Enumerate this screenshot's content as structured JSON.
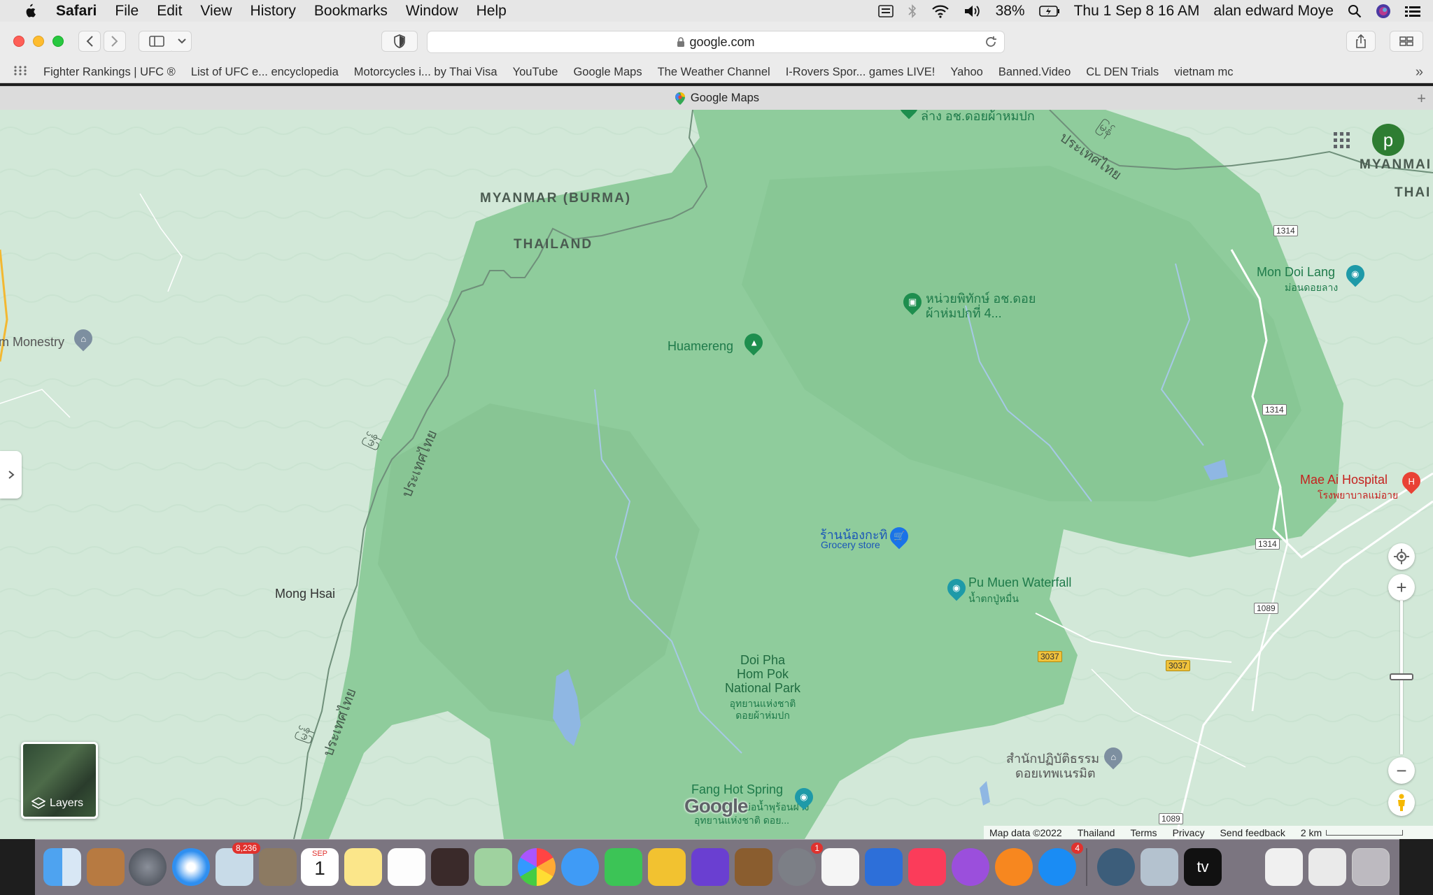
{
  "menubar": {
    "app": "Safari",
    "items": [
      "File",
      "Edit",
      "View",
      "History",
      "Bookmarks",
      "Window",
      "Help"
    ],
    "battery": "38%",
    "datetime": "Thu 1 Sep  8 16 AM",
    "user": "alan edward Moye"
  },
  "toolbar": {
    "url": "google.com"
  },
  "bookmarks": [
    "Fighter Rankings | UFC ®",
    "List of UFC e... encyclopedia",
    "Motorcycles i... by Thai Visa",
    "YouTube",
    "Google Maps",
    "The Weather Channel",
    "I-Rovers Spor... games LIVE!",
    "Yahoo",
    "Banned.Video",
    "CL DEN Trials",
    "vietnam mc"
  ],
  "tab": {
    "title": "Google Maps"
  },
  "map": {
    "avatar_letter": "p",
    "labels": {
      "myanmar_burma": "MYANMAR (BURMA)",
      "thailand": "THAILAND",
      "myanmar_right": "MYANMAI",
      "thai_right": "THAI",
      "thai_script_1": "ประเทศไทย",
      "thai_script_2": "ประเทศไทย",
      "thai_script_3": "ประเทศไทย",
      "burmese_1": "မြန်",
      "burmese_2": "မြန်",
      "burmese_3": "မြန်",
      "monestry": "m Monestry",
      "mong_hsai": "Mong Hsai",
      "huamereng": "Huamereng",
      "unit_name_1": "หน่วยพิทักษ์ อช.ดอย",
      "unit_name_2": "ผ้าห่มปกที่ 4...",
      "top_partial": "ล่าง อช.ดอยผ้าหมปก",
      "mon_doi_lang": "Mon Doi Lang",
      "mon_doi_lang_th": "ม่อนดอยลาง",
      "grocery_name": "ร้านน้องกะทิ",
      "grocery_type": "Grocery store",
      "waterfall": "Pu Muen Waterfall",
      "waterfall_th": "น้ำตกปู่หมื่น",
      "park_1": "Doi Pha",
      "park_2": "Hom Pok",
      "park_3": "National Park",
      "park_th_1": "อุทยานแห่งชาติ",
      "park_th_2": "ดอยผ้าห่มปก",
      "hospital": "Mae Ai Hospital",
      "hospital_th": "โรงพยาบาลแม่อาย",
      "temple_1": "สำนักปฏิบัติธรรม",
      "temple_2": "ดอยเทพเนรมิต",
      "hot_spring": "Fang Hot Spring",
      "hot_spring_th": "อุทยานแห่งชาติ ดอย...",
      "hot_spring_partial": "บ่อน้ำพุร้อนฝาง",
      "google_logo": "Google"
    },
    "roads": {
      "r1314a": "1314",
      "r1314b": "1314",
      "r1314c": "1314",
      "r1089a": "1089",
      "r1089b": "1089",
      "r3037a": "3037",
      "r3037b": "3037"
    },
    "layers_label": "Layers",
    "footer": {
      "mapdata": "Map data ©2022",
      "region": "Thailand",
      "terms": "Terms",
      "privacy": "Privacy",
      "feedback": "Send feedback",
      "scale": "2 km"
    }
  },
  "dock": {
    "mail_badge": "8,236",
    "calendar_month": "SEP",
    "calendar_day": "1",
    "settings_badge": "1",
    "appstore_badge": "4",
    "tv_label": "tv"
  }
}
